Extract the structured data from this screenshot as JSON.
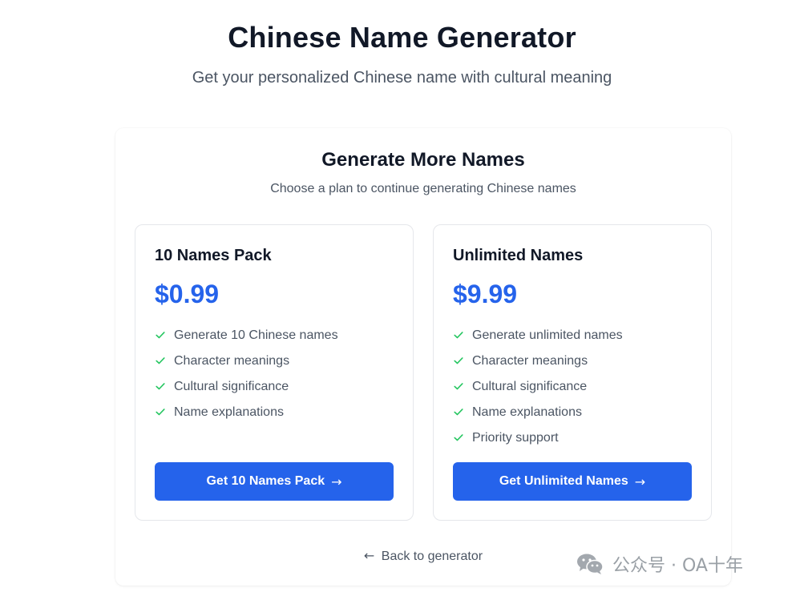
{
  "header": {
    "title": "Chinese Name Generator",
    "subtitle": "Get your personalized Chinese name with cultural meaning"
  },
  "panel": {
    "title": "Generate More Names",
    "subtitle": "Choose a plan to continue generating Chinese names"
  },
  "plans": [
    {
      "name": "10 Names Pack",
      "price": "$0.99",
      "features": [
        "Generate 10 Chinese names",
        "Character meanings",
        "Cultural significance",
        "Name explanations"
      ],
      "button_label": "Get 10 Names Pack",
      "button_arrow": "→"
    },
    {
      "name": "Unlimited Names",
      "price": "$9.99",
      "features": [
        "Generate unlimited names",
        "Character meanings",
        "Cultural significance",
        "Name explanations",
        "Priority support"
      ],
      "button_label": "Get Unlimited Names",
      "button_arrow": "→"
    }
  ],
  "back_link": {
    "arrow": "←",
    "label": "Back to generator"
  },
  "watermark": {
    "text": "公众号 · OA十年"
  },
  "colors": {
    "accent": "#2563eb",
    "check": "#22c55e",
    "text_primary": "#111827",
    "text_secondary": "#4b5563",
    "border": "#e5e7eb"
  },
  "icons": {
    "feature_check": "check-icon",
    "watermark": "wechat-icon"
  }
}
